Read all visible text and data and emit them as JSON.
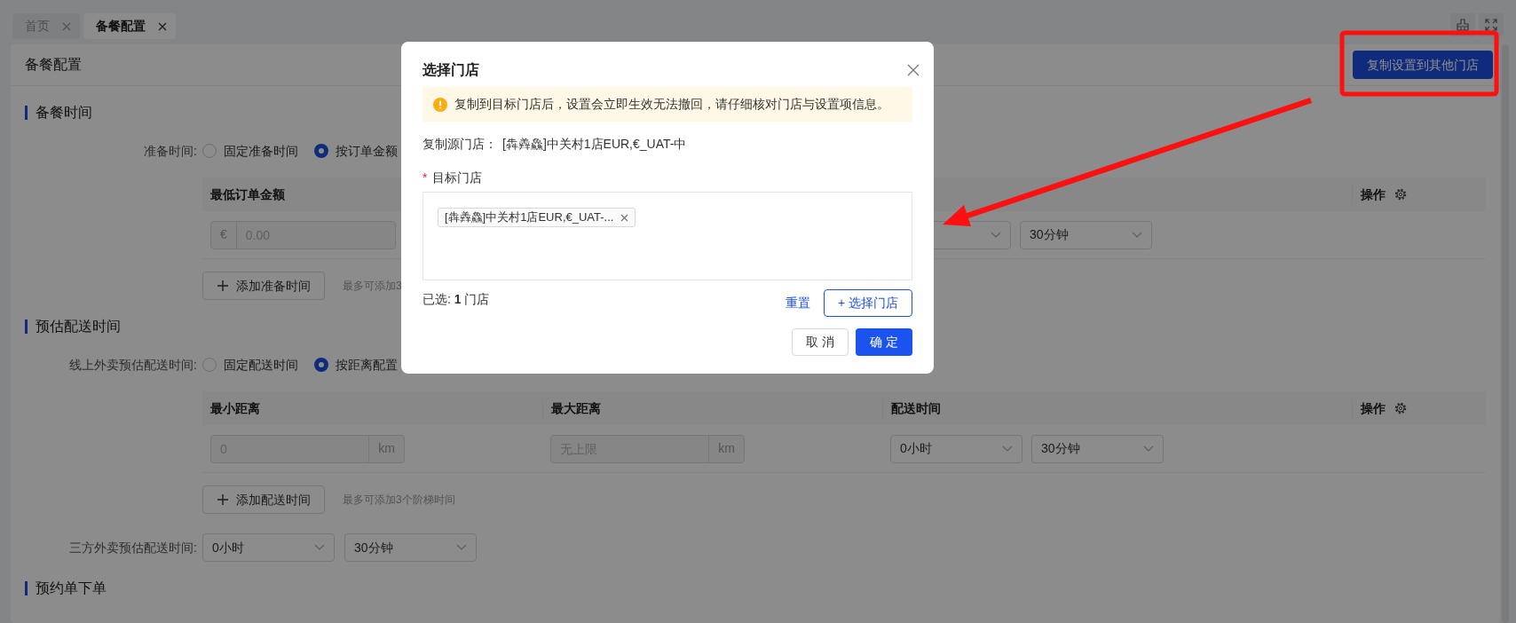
{
  "tabs": [
    {
      "label": "首页",
      "selected": false
    },
    {
      "label": "备餐配置",
      "selected": true
    }
  ],
  "page": {
    "title": "备餐配置",
    "copy_button": "复制设置到其他门店"
  },
  "sections": [
    {
      "title": "备餐时间",
      "blocks": [
        {
          "kind": "radio",
          "label": "准备时间:",
          "options": [
            {
              "label": "固定准备时间",
              "selected": false
            },
            {
              "label": "按订单金额",
              "selected": true
            }
          ]
        },
        {
          "kind": "table",
          "columns": [
            {
              "label": "最低订单金额",
              "cells": [
                {
                  "kind": "prefix-input",
                  "prefix": "€",
                  "placeholder": "0.00"
                }
              ]
            },
            {
              "cells": [
                {
                  "kind": "select"
                },
                {
                  "kind": "select",
                  "value": "30分钟"
                }
              ]
            },
            {
              "label": "操作",
              "kind": "actions"
            }
          ]
        },
        {
          "kind": "add",
          "button": "添加准备时间",
          "hint": "最多可添加3"
        }
      ]
    },
    {
      "title": "预估配送时间",
      "blocks": [
        {
          "kind": "radio",
          "label": "线上外卖预估配送时间:",
          "options": [
            {
              "label": "固定配送时间",
              "selected": false
            },
            {
              "label": "按距离配置",
              "selected": true
            }
          ]
        },
        {
          "kind": "table",
          "columns": [
            {
              "label": "最小距离",
              "cells": [
                {
                  "kind": "suffix-input",
                  "placeholder": "0",
                  "suffix": "km"
                }
              ]
            },
            {
              "label": "最大距离",
              "cells": [
                {
                  "kind": "suffix-input",
                  "placeholder": "无上限",
                  "suffix": "km"
                }
              ]
            },
            {
              "label": "配送时间",
              "cells": [
                {
                  "kind": "select",
                  "value": "0小时"
                },
                {
                  "kind": "select",
                  "value": "30分钟"
                }
              ]
            },
            {
              "label": "操作",
              "kind": "actions"
            }
          ]
        },
        {
          "kind": "add",
          "button": "添加配送时间",
          "hint": "最多可添加3个阶梯时间"
        },
        {
          "kind": "selects",
          "label": "三方外卖预估配送时间:",
          "values": [
            "0小时",
            "30分钟"
          ]
        }
      ]
    },
    {
      "title": "预约单下单"
    }
  ],
  "modal": {
    "title": "选择门店",
    "alert": "复制到目标门店后，设置会立即生效无法撤回，请仔细核对门店与设置项信息。",
    "source_label": "复制源门店：",
    "source_value": "[犇羴鱻]中关村1店EUR,€_UAT-中",
    "required_mark": "*",
    "target_label": "目标门店",
    "tags": [
      "[犇羴鱻]中关村1店EUR,€_UAT-..."
    ],
    "selected_count": "已选: **1** 门店",
    "reset": "重置",
    "select_button": "+ 选择门店",
    "cancel": "取 消",
    "ok": "确 定"
  }
}
